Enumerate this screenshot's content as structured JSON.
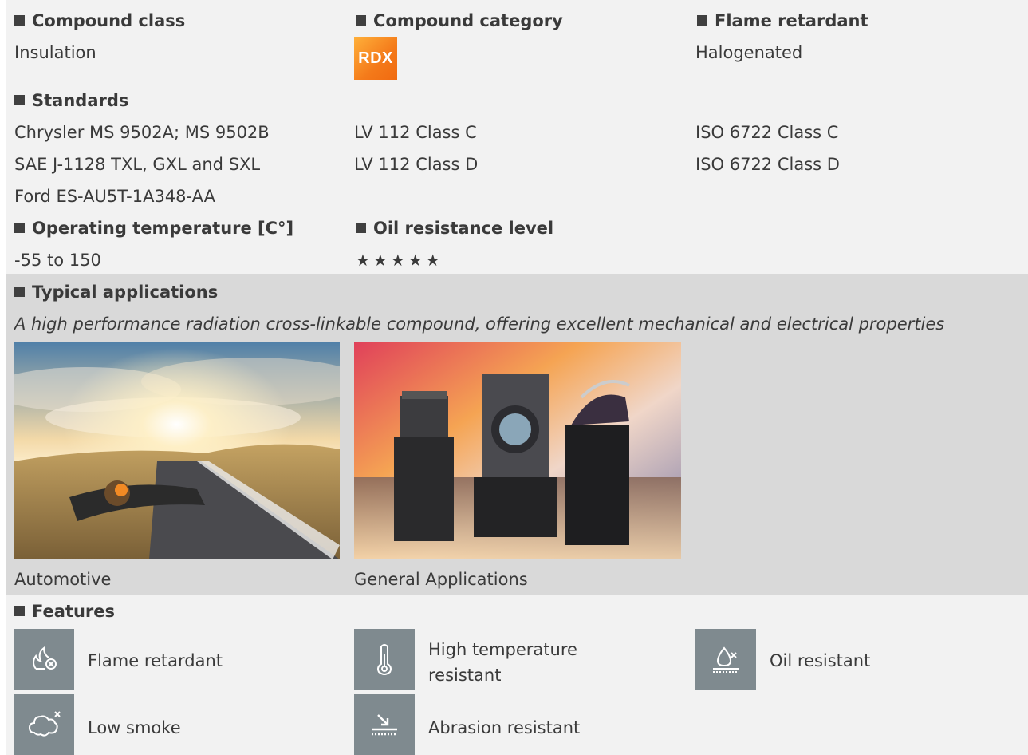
{
  "compound_class": {
    "label": "Compound class",
    "value": "Insulation"
  },
  "compound_category": {
    "label": "Compound category",
    "badge": "RDX",
    "badge_color": "#f47a1a"
  },
  "flame_retardant": {
    "label": "Flame retardant",
    "value": "Halogenated"
  },
  "standards": {
    "label": "Standards",
    "col1": [
      "Chrysler MS 9502A; MS 9502B",
      "SAE J-1128 TXL, GXL and SXL",
      "Ford ES-AU5T-1A348-AA"
    ],
    "col2": [
      "LV 112 Class C",
      "LV 112 Class D"
    ],
    "col3": [
      "ISO 6722 Class C",
      "ISO 6722 Class D"
    ]
  },
  "operating_temperature": {
    "label": "Operating temperature [C°]",
    "value": "-55 to 150"
  },
  "oil_resistance": {
    "label": "Oil resistance level",
    "stars": "★★★★★",
    "rating": 5
  },
  "typical_applications": {
    "label": "Typical applications",
    "description": "A high performance radiation cross-linkable compound, offering excellent mechanical and electrical properties",
    "items": [
      {
        "caption": "Automotive"
      },
      {
        "caption": "General Applications"
      }
    ]
  },
  "features": {
    "label": "Features",
    "items": [
      {
        "label": "Flame retardant",
        "icon": "flame-retardant-icon"
      },
      {
        "label": "High temperature resistant",
        "icon": "thermometer-icon"
      },
      {
        "label": "Oil resistant",
        "icon": "oil-drop-icon"
      },
      {
        "label": "Low smoke",
        "icon": "smoke-cloud-icon"
      },
      {
        "label": "Abrasion resistant",
        "icon": "abrasion-icon"
      }
    ]
  },
  "colors": {
    "band_light": "#f2f2f2",
    "band_dark": "#d9d9d9",
    "icon_bg": "#7f8a8f",
    "text": "#3a3a3a"
  }
}
